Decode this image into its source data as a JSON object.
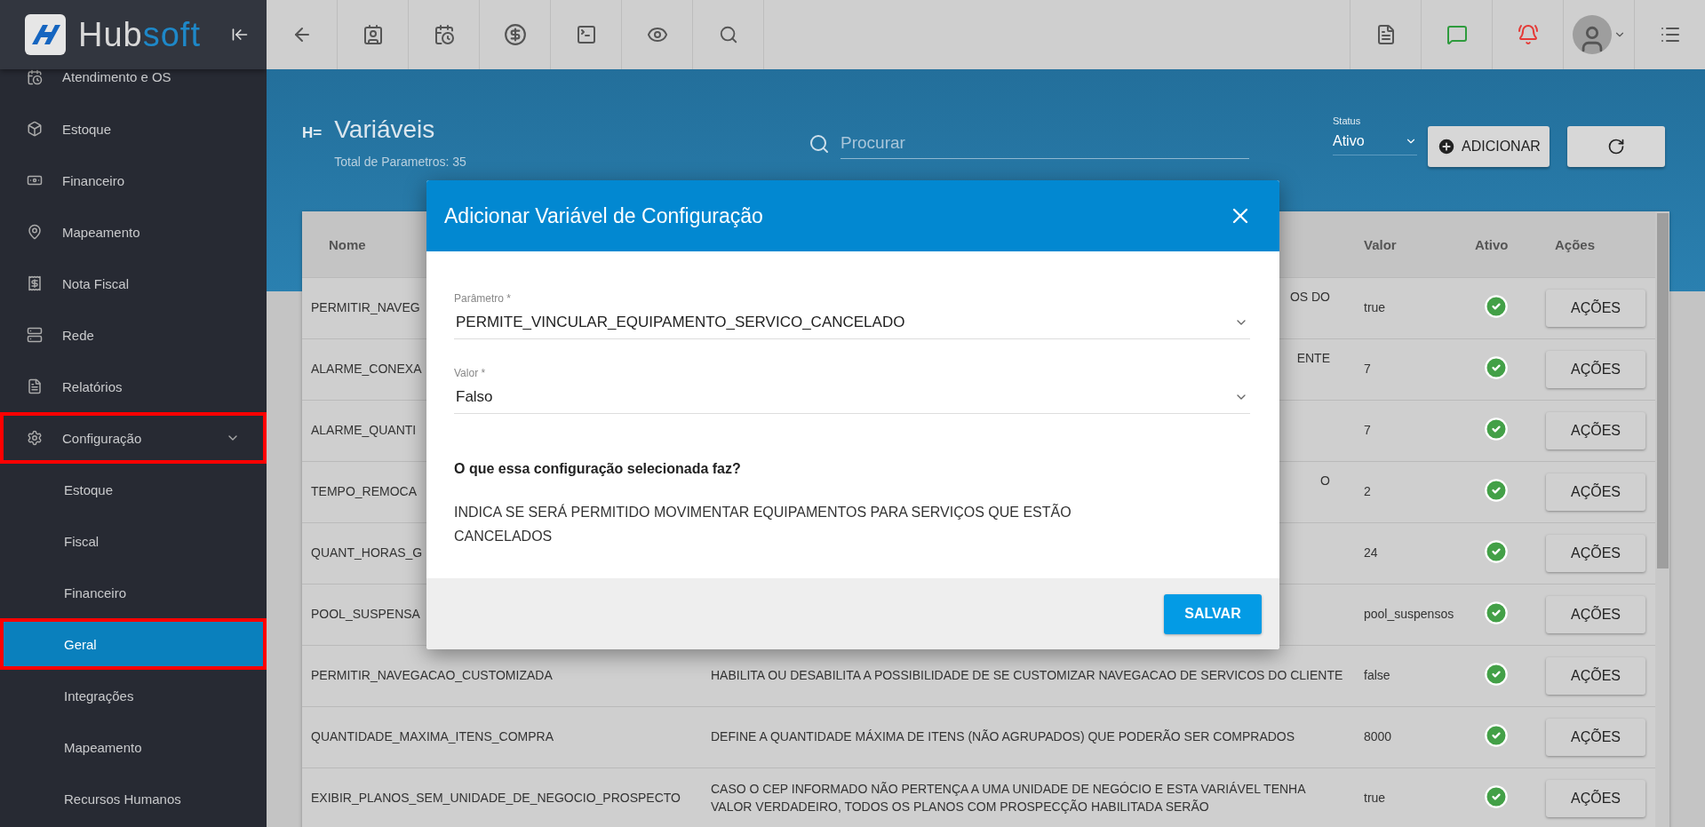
{
  "sidebar": {
    "logo": {
      "main": "Hub",
      "accent": "soft"
    },
    "items": [
      {
        "label": "Atendimento e OS",
        "highlighted": false
      },
      {
        "label": "Estoque",
        "highlighted": false
      },
      {
        "label": "Financeiro",
        "highlighted": false
      },
      {
        "label": "Mapeamento",
        "highlighted": false
      },
      {
        "label": "Nota Fiscal",
        "highlighted": false
      },
      {
        "label": "Rede",
        "highlighted": false
      },
      {
        "label": "Relatórios",
        "highlighted": false
      },
      {
        "label": "Configuração",
        "highlighted": true,
        "expanded": true,
        "children": [
          {
            "label": "Estoque",
            "selected": false,
            "highlighted": false
          },
          {
            "label": "Fiscal",
            "selected": false,
            "highlighted": false
          },
          {
            "label": "Financeiro",
            "selected": false,
            "highlighted": false
          },
          {
            "label": "Geral",
            "selected": true,
            "highlighted": true
          },
          {
            "label": "Integrações",
            "selected": false,
            "highlighted": false
          },
          {
            "label": "Mapeamento",
            "selected": false,
            "highlighted": false
          },
          {
            "label": "Recursos Humanos",
            "selected": false,
            "highlighted": false
          }
        ]
      }
    ]
  },
  "header": {
    "icon": "H=",
    "title": "Variáveis",
    "subtitle": "Total de Parametros: 35",
    "search": {
      "placeholder": "Procurar"
    },
    "status": {
      "label": "Status",
      "value": "Ativo"
    },
    "add_button": "ADICIONAR"
  },
  "table": {
    "columns": [
      "Nome",
      "Valor",
      "Ativo",
      "Ações"
    ],
    "rows": [
      {
        "name": "PERMITIR_NAVEG",
        "description": "OS DO",
        "partial": true,
        "value": "true",
        "active": true,
        "action": "AÇÕES"
      },
      {
        "name": "ALARME_CONEXA",
        "description": "ENTE",
        "partial": true,
        "value": "7",
        "active": true,
        "action": "AÇÕES"
      },
      {
        "name": "ALARME_QUANTI",
        "value": "7",
        "active": true,
        "action": "AÇÕES"
      },
      {
        "name": "TEMPO_REMOCA",
        "description": "O",
        "partial": true,
        "value": "2",
        "active": true,
        "action": "AÇÕES"
      },
      {
        "name": "QUANT_HORAS_G",
        "value": "24",
        "active": true,
        "action": "AÇÕES"
      },
      {
        "name": "POOL_SUSPENSA",
        "value": "pool_suspensos",
        "active": true,
        "action": "AÇÕES"
      },
      {
        "name": "PERMITIR_NAVEGACAO_CUSTOMIZADA",
        "description": "HABILITA OU DESABILITA A POSSIBILIDADE DE SE CUSTOMIZAR NAVEGACAO DE SERVICOS DO CLIENTE",
        "partial": false,
        "value": "false",
        "active": true,
        "action": "AÇÕES"
      },
      {
        "name": "QUANTIDADE_MAXIMA_ITENS_COMPRA",
        "description": "DEFINE A QUANTIDADE MÁXIMA DE ITENS (NÃO AGRUPADOS) QUE PODERÃO SER COMPRADOS",
        "partial": false,
        "value": "8000",
        "active": true,
        "action": "AÇÕES"
      },
      {
        "name": "EXIBIR_PLANOS_SEM_UNIDADE_DE_NEGOCIO_PROSPECTO",
        "description": "CASO O CEP INFORMADO NÃO PERTENÇA A UMA UNIDADE DE NEGÓCIO E ESTA VARIÁVEL TENHA VALOR VERDADEIRO, TODOS OS PLANOS COM PROSPECÇÃO HABILITADA SERÃO",
        "partial": false,
        "value": "true",
        "active": true,
        "action": "AÇÕES"
      }
    ]
  },
  "modal": {
    "title": "Adicionar Variável de Configuração",
    "fields": [
      {
        "label": "Parâmetro *",
        "value": "PERMITE_VINCULAR_EQUIPAMENTO_SERVICO_CANCELADO"
      },
      {
        "label": "Valor *",
        "value": "Falso"
      }
    ],
    "question": "O que essa configuração selecionada faz?",
    "answer": "INDICA SE SERÁ PERMITIDO MOVIMENTAR EQUIPAMENTOS PARA SERVIÇOS QUE ESTÃO CANCELADOS",
    "save_button": "SALVAR"
  }
}
